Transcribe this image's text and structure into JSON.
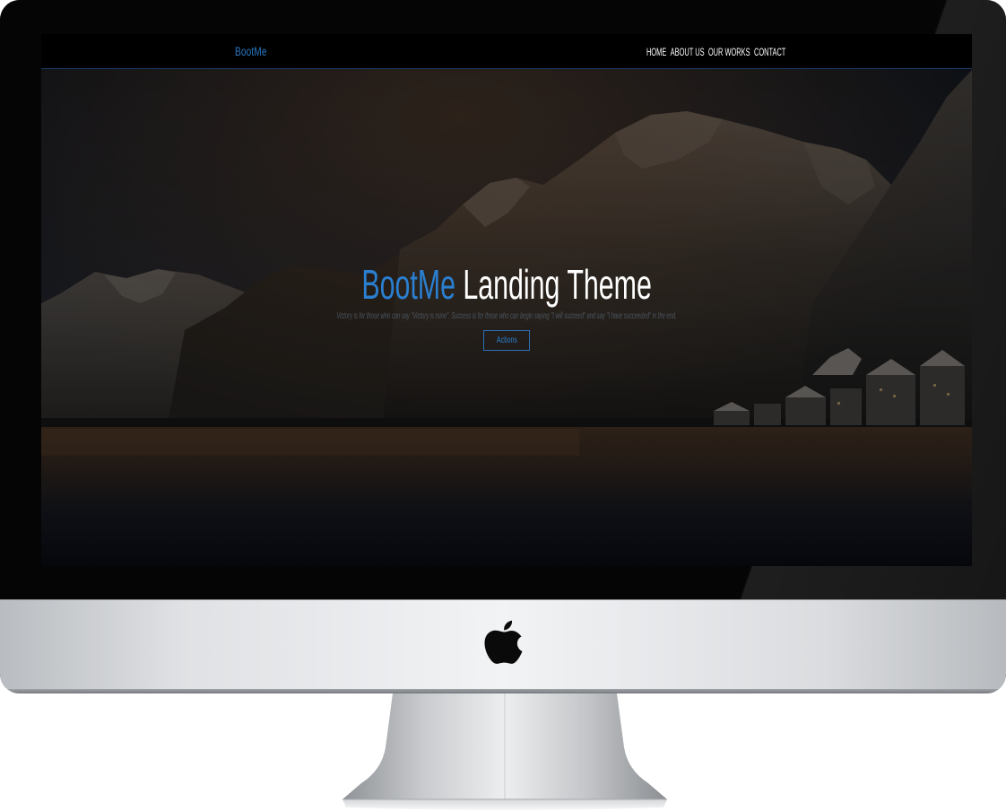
{
  "site": {
    "brand": "BootMe",
    "nav": [
      "HOME",
      "ABOUT US",
      "OUR WORKS",
      "CONTACT"
    ],
    "hero": {
      "title_accent": "BootMe",
      "title_rest": "Landing Theme",
      "subtitle": "Victory is for those who can say \"Victory is mine\". Success is for those who can begin saying \"I will succeed\" and say \"I have succeeded\" in the end.",
      "button": "Actions"
    }
  },
  "colors": {
    "accent": "#2b7fd0",
    "navbar_bg": "#000000",
    "bezel": "#050505",
    "chin_silver": "#e4e6e9"
  },
  "icons": {
    "device_logo": "apple-logo-icon"
  }
}
